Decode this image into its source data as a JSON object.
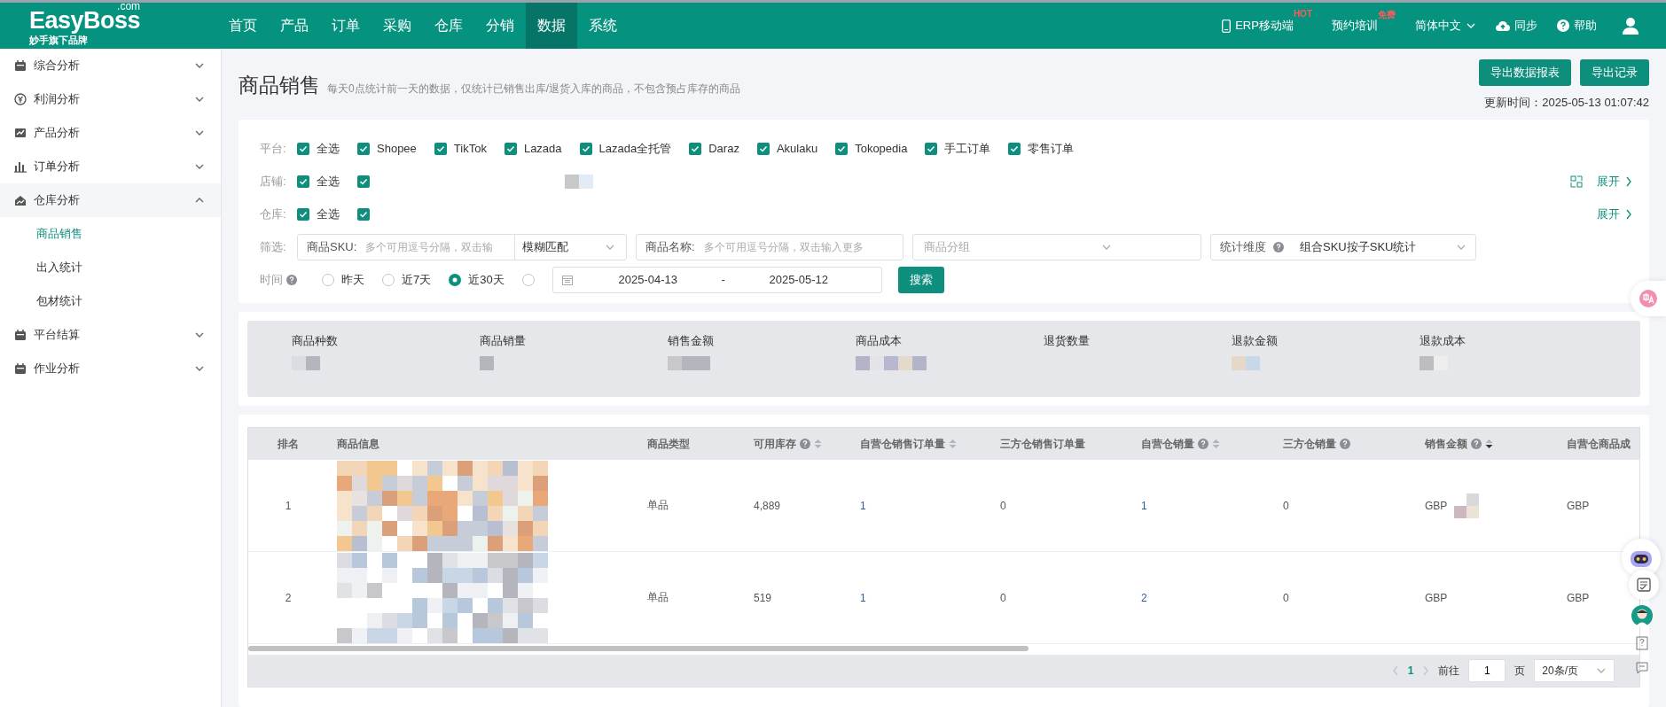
{
  "topbar": {
    "logo": "EasyBoss",
    "logo_sup": ".com",
    "tagline": "妙手旗下品牌",
    "nav": [
      {
        "label": "首页",
        "selected": false
      },
      {
        "label": "产品",
        "selected": false
      },
      {
        "label": "订单",
        "selected": false
      },
      {
        "label": "采购",
        "selected": false
      },
      {
        "label": "仓库",
        "selected": false
      },
      {
        "label": "分销",
        "selected": false
      },
      {
        "label": "数据",
        "selected": true
      },
      {
        "label": "系统",
        "selected": false
      }
    ],
    "tools": [
      {
        "kind": "phone",
        "label": "ERP移动端",
        "badge": "HOT"
      },
      {
        "kind": "plain",
        "label": "预约培训",
        "badge": "免费"
      },
      {
        "kind": "dropdown",
        "label": "简体中文"
      },
      {
        "kind": "cloud",
        "label": "同步"
      },
      {
        "kind": "help",
        "label": "帮助"
      },
      {
        "kind": "user"
      }
    ]
  },
  "sidebar": {
    "items": [
      {
        "kind": "calendar",
        "label": "综合分析",
        "expanded": false
      },
      {
        "kind": "coin",
        "label": "利润分析",
        "expanded": false
      },
      {
        "kind": "chart",
        "label": "产品分析",
        "expanded": false
      },
      {
        "kind": "bars",
        "label": "订单分析",
        "expanded": false
      },
      {
        "kind": "house",
        "label": "仓库分析",
        "expanded": true,
        "children": [
          {
            "label": "商品销售",
            "selected": true
          },
          {
            "label": "出入统计",
            "selected": false
          },
          {
            "label": "包材统计",
            "selected": false
          }
        ]
      },
      {
        "kind": "calendar",
        "label": "平台结算",
        "expanded": false
      },
      {
        "kind": "calendar",
        "label": "作业分析",
        "expanded": false
      }
    ]
  },
  "page": {
    "title": "商品销售",
    "subtitle": "每天0点统计前一天的数据，仅统计已销售出库/退货入库的商品，不包含预占库存的商品",
    "buttons": [
      "导出数据报表",
      "导出记录"
    ],
    "update_time": "更新时间：2025-05-13 01:07:42"
  },
  "filters": {
    "platform": {
      "label": "平台:",
      "options": [
        {
          "label": "全选",
          "checked": true
        },
        {
          "label": "Shopee",
          "checked": true
        },
        {
          "label": "TikTok",
          "checked": true
        },
        {
          "label": "Lazada",
          "checked": true
        },
        {
          "label": "Lazada全托管",
          "checked": true
        },
        {
          "label": "Daraz",
          "checked": true
        },
        {
          "label": "Akulaku",
          "checked": true
        },
        {
          "label": "Tokopedia",
          "checked": true
        },
        {
          "label": "手工订单",
          "checked": true
        },
        {
          "label": "零售订单",
          "checked": true
        }
      ]
    },
    "shop": {
      "label": "店铺:",
      "options": [
        {
          "label": "全选",
          "checked": true
        },
        {
          "checked": true
        }
      ],
      "expand": "展开"
    },
    "warehouse": {
      "label": "仓库:",
      "options": [
        {
          "label": "全选",
          "checked": true
        },
        {
          "checked": true
        }
      ],
      "expand": "展开"
    },
    "screen": {
      "label": "筛选:",
      "sku_label": "商品SKU:",
      "sku_placeholder": "多个可用逗号分隔，双击输",
      "match": "模糊匹配",
      "name_label": "商品名称:",
      "name_placeholder": "多个可用逗号分隔，双击输入更多",
      "group_placeholder": "商品分组",
      "dim_label": "统计维度",
      "dim_value": "组合SKU按子SKU统计"
    },
    "time": {
      "label": "时间",
      "options": [
        {
          "label": "昨天",
          "selected": false
        },
        {
          "label": "近7天",
          "selected": false
        },
        {
          "label": "近30天",
          "selected": true
        },
        {
          "selected": false
        }
      ],
      "start": "2025-04-13",
      "sep": "-",
      "end": "2025-05-12",
      "search": "搜索"
    }
  },
  "stats": [
    {
      "label": "商品种数"
    },
    {
      "label": "商品销量"
    },
    {
      "label": "销售金额"
    },
    {
      "label": "商品成本"
    },
    {
      "label": "退货数量"
    },
    {
      "label": "退款金额"
    },
    {
      "label": "退款成本"
    }
  ],
  "table": {
    "columns": [
      {
        "label": "排名"
      },
      {
        "label": "商品信息"
      },
      {
        "label": "商品类型"
      },
      {
        "label": "可用库存",
        "help": true,
        "sortable": true,
        "sorted_desc": false
      },
      {
        "label": "自营仓销售订单量",
        "sortable": true,
        "sorted_desc": false
      },
      {
        "label": "三方仓销售订单量"
      },
      {
        "label": "自营仓销量",
        "help": true,
        "sortable": true,
        "sorted_desc": false
      },
      {
        "label": "三方仓销量",
        "help": true
      },
      {
        "label": "销售金额",
        "help": true,
        "sortable": true,
        "sorted_desc": true
      },
      {
        "label": "自营仓商品成"
      }
    ],
    "rows": [
      {
        "cells": [
          "1",
          "",
          "单品",
          "4,889",
          "1",
          "0",
          "1",
          "0",
          "GBP",
          "GBP"
        ]
      },
      {
        "cells": [
          "2",
          "",
          "单品",
          "519",
          "1",
          "0",
          "2",
          "0",
          "GBP",
          "GBP"
        ]
      }
    ]
  },
  "pagination": {
    "current": "1",
    "goto_label": "前往",
    "goto_value": "1",
    "page_unit": "页",
    "page_size": "20条/页"
  }
}
